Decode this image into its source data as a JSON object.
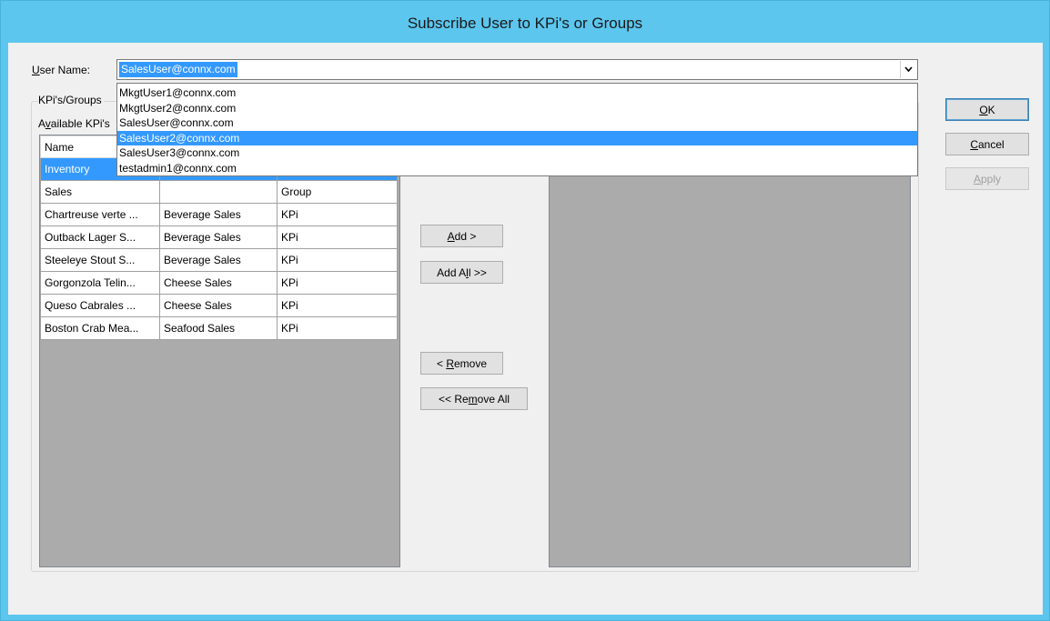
{
  "window": {
    "title": "Subscribe User to KPi's or Groups"
  },
  "user_name": {
    "label": "User Name:",
    "selected": "SalesUser@connx.com",
    "options": [
      "MkgtUser1@connx.com",
      "MkgtUser2@connx.com",
      "SalesUser@connx.com",
      "SalesUser2@connx.com",
      "SalesUser3@connx.com",
      "testadmin1@connx.com"
    ],
    "highlighted_option": "SalesUser2@connx.com"
  },
  "group_label": "KPi's/Groups",
  "available_label": "Available KPi's",
  "available_table": {
    "headers": [
      "Name",
      "",
      ""
    ],
    "rows": [
      [
        "Inventory",
        "",
        ""
      ],
      [
        "Sales",
        "",
        "Group"
      ],
      [
        "Chartreuse verte ...",
        "Beverage Sales",
        "KPi"
      ],
      [
        "Outback Lager S...",
        "Beverage Sales",
        "KPi"
      ],
      [
        "Steeleye Stout S...",
        "Beverage Sales",
        "KPi"
      ],
      [
        "Gorgonzola Telin...",
        "Cheese Sales",
        "KPi"
      ],
      [
        "Queso Cabrales ...",
        "Cheese Sales",
        "KPi"
      ],
      [
        "Boston Crab Mea...",
        "Seafood Sales",
        "KPi"
      ]
    ],
    "selected_row": 0
  },
  "buttons": {
    "add": "Add >",
    "add_all": "Add All >>",
    "remove": "< Remove",
    "remove_all": "<< Remove All",
    "ok": "OK",
    "cancel": "Cancel",
    "apply": "Apply"
  },
  "colors": {
    "title_bar": "#5cc6ee",
    "selection": "#3399ff",
    "list_background": "#ababab"
  }
}
